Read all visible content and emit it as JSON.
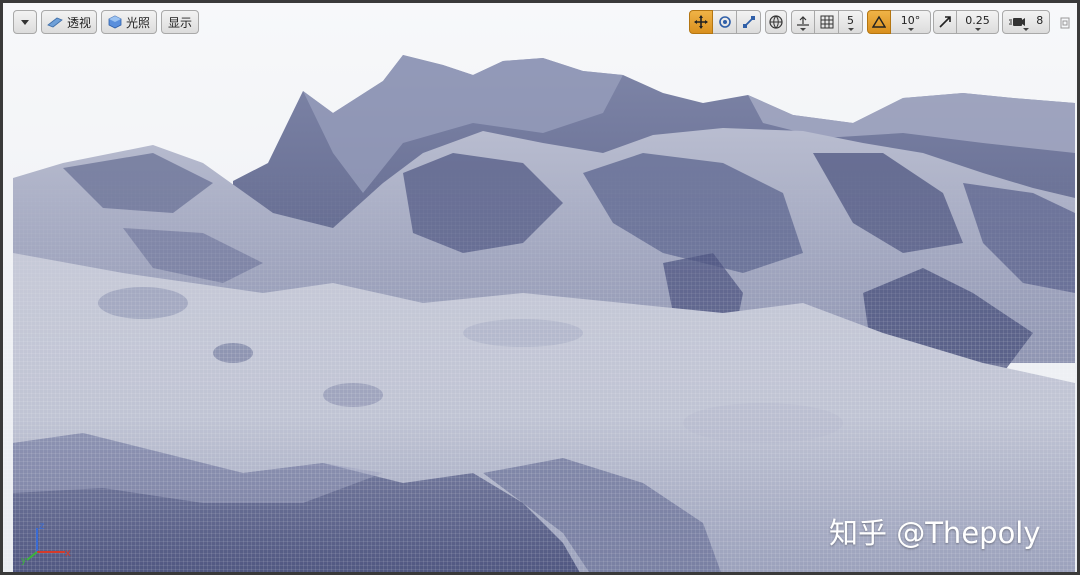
{
  "toolbar": {
    "view_mode_label": "透视",
    "lighting_label": "光照",
    "show_label": "显示",
    "grid_snap_value": "5",
    "rotation_snap_value": "10°",
    "scale_snap_value": "0.25",
    "camera_speed_value": "8"
  },
  "watermark": {
    "text": "知乎 @Thepoly"
  },
  "colors": {
    "accent": "#e0a030",
    "axis_x": "#d43a2a",
    "axis_y": "#3bb53b",
    "axis_z": "#3a6bd4"
  },
  "icons": [
    "dropdown-arrow-icon",
    "perspective-icon",
    "lit-mode-icon",
    "translate-icon",
    "rotate-icon",
    "scale-icon",
    "world-local-icon",
    "surface-snap-icon",
    "grid-snap-icon",
    "rotation-snap-icon",
    "scale-snap-icon",
    "camera-speed-icon",
    "maximize-icon"
  ]
}
